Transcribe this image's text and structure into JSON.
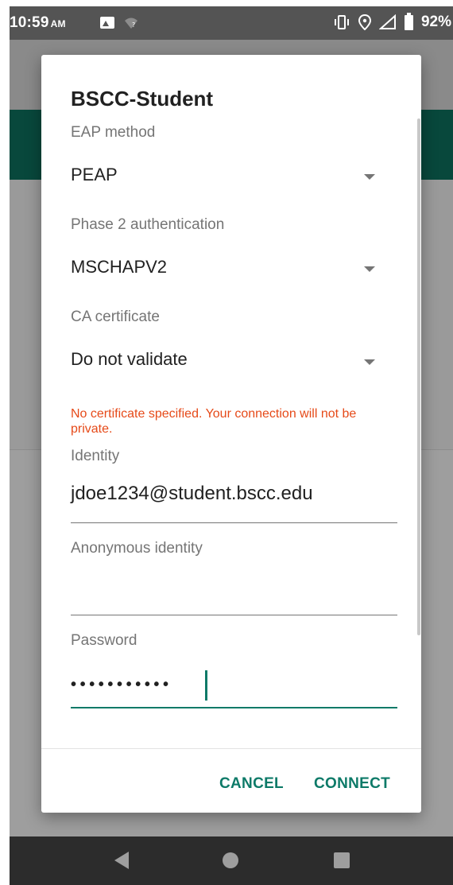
{
  "status_bar": {
    "time": "10:59",
    "ampm": "AM",
    "battery": "92%",
    "icons": [
      "gallery-icon",
      "wifi-question-icon",
      "vibrate-icon",
      "location-icon",
      "signal-icon",
      "battery-icon"
    ]
  },
  "dialog": {
    "title": "BSCC-Student",
    "eap_method": {
      "label": "EAP method",
      "value": "PEAP"
    },
    "phase2": {
      "label": "Phase 2 authentication",
      "value": "MSCHAPV2"
    },
    "ca_certificate": {
      "label": "CA certificate",
      "value": "Do not validate"
    },
    "warning": "No certificate specified. Your connection will not be private.",
    "identity": {
      "label": "Identity",
      "value": "jdoe1234@student.bscc.edu"
    },
    "anonymous_identity": {
      "label": "Anonymous identity",
      "value": ""
    },
    "password": {
      "label": "Password",
      "masked": "•••••••••••"
    },
    "buttons": {
      "cancel": "CANCEL",
      "connect": "CONNECT"
    }
  },
  "colors": {
    "accent": "#0d7a68",
    "warning": "#e64a19",
    "app_bar": "#08483c"
  },
  "nav_bar": {
    "icons": [
      "back-icon",
      "home-icon",
      "recents-icon"
    ]
  }
}
